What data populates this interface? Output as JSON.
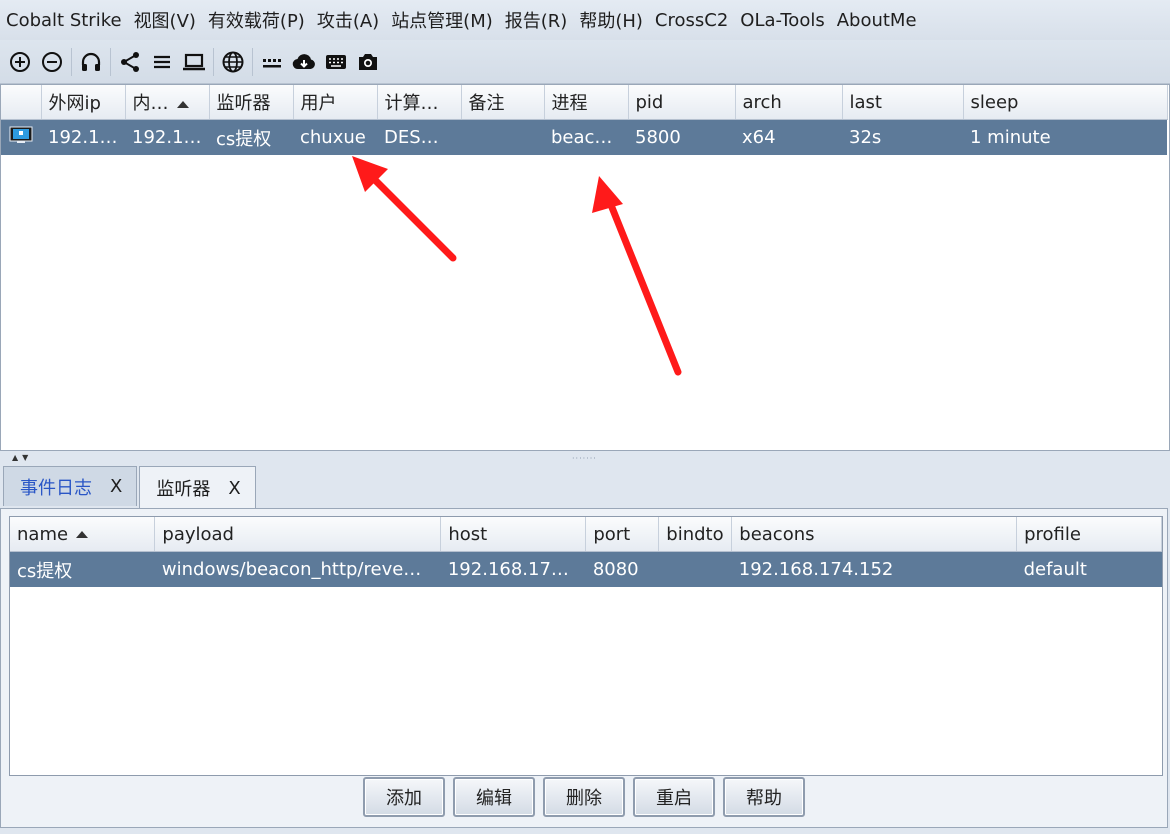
{
  "menu": [
    "Cobalt Strike",
    "视图(V)",
    "有效载荷(P)",
    "攻击(A)",
    "站点管理(M)",
    "报告(R)",
    "帮助(H)",
    "CrossC2",
    "OLa-Tools",
    "AboutMe"
  ],
  "toolbar_icons": [
    "add-icon",
    "remove-icon",
    "headphones-icon",
    "share-icon",
    "list-icon",
    "laptop-icon",
    "globe-icon",
    "keyboard-dots-icon",
    "cloud-download-icon",
    "keyboard-icon",
    "camera-icon"
  ],
  "sessions": {
    "columns": [
      "",
      "外网ip",
      "内…",
      "监听器",
      "用户",
      "计算…",
      "备注",
      "进程",
      "pid",
      "arch",
      "last",
      "sleep"
    ],
    "sorted_column": "内…",
    "rows": [
      {
        "external": "192.1…",
        "internal": "192.1…",
        "listener": "cs提权",
        "user": "chuxue",
        "computer": "DES…",
        "note": "",
        "process": "beac…",
        "pid": "5800",
        "arch": "x64",
        "last": "32s",
        "sleep": "1 minute"
      }
    ]
  },
  "tabs": [
    {
      "label": "事件日志",
      "close": "X"
    },
    {
      "label": "监听器",
      "close": "X"
    }
  ],
  "listeners": {
    "columns": [
      "name",
      "payload",
      "host",
      "port",
      "bindto",
      "beacons",
      "profile"
    ],
    "rows": [
      {
        "name": "cs提权",
        "payload": "windows/beacon_http/reve…",
        "host": "192.168.17…",
        "port": "8080",
        "bindto": "",
        "beacons": "192.168.174.152",
        "profile": "default"
      }
    ]
  },
  "buttons": {
    "add": "添加",
    "edit": "编辑",
    "delete": "删除",
    "restart": "重启",
    "help": "帮助"
  },
  "colors": {
    "selection": "#5d7a99",
    "annotation": "#ff1a1a"
  }
}
